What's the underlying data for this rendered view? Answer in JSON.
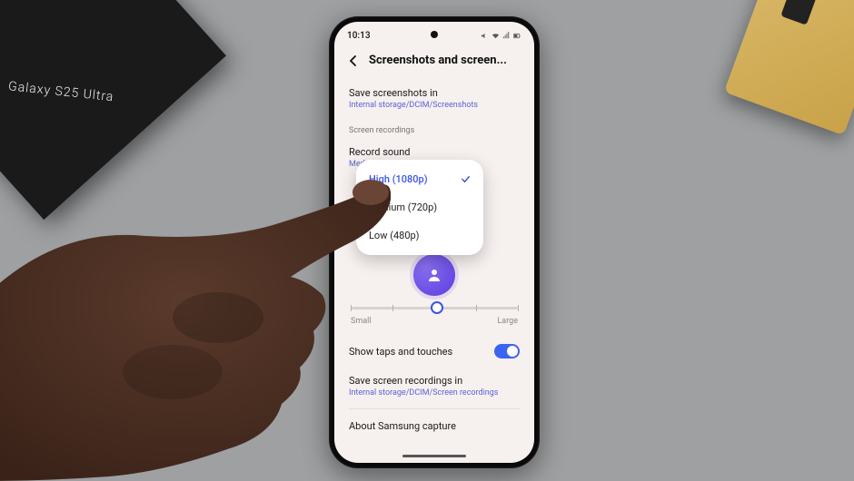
{
  "statusbar": {
    "time": "10:13"
  },
  "header": {
    "title": "Screenshots and screen..."
  },
  "save_screenshots": {
    "title": "Save screenshots in",
    "path": "Internal storage/DCIM/Screenshots"
  },
  "section_label": "Screen recordings",
  "record_sound": {
    "title": "Record sound",
    "value": "Media"
  },
  "video_quality_popup": {
    "options": [
      {
        "label": "High (1080p)",
        "selected": true
      },
      {
        "label": "Medium (720p)",
        "selected": false
      },
      {
        "label": "Low (480p)",
        "selected": false
      }
    ]
  },
  "size_slider": {
    "min_label": "Small",
    "max_label": "Large",
    "position": 0.5
  },
  "show_taps": {
    "title": "Show taps and touches",
    "enabled": true
  },
  "save_recordings": {
    "title": "Save screen recordings in",
    "path": "Internal storage/DCIM/Screen recordings"
  },
  "about": {
    "title": "About Samsung capture"
  },
  "product_box_text": "Galaxy S25 Ultra",
  "colors": {
    "accent": "#3b54e6",
    "link": "#5a63d6"
  }
}
